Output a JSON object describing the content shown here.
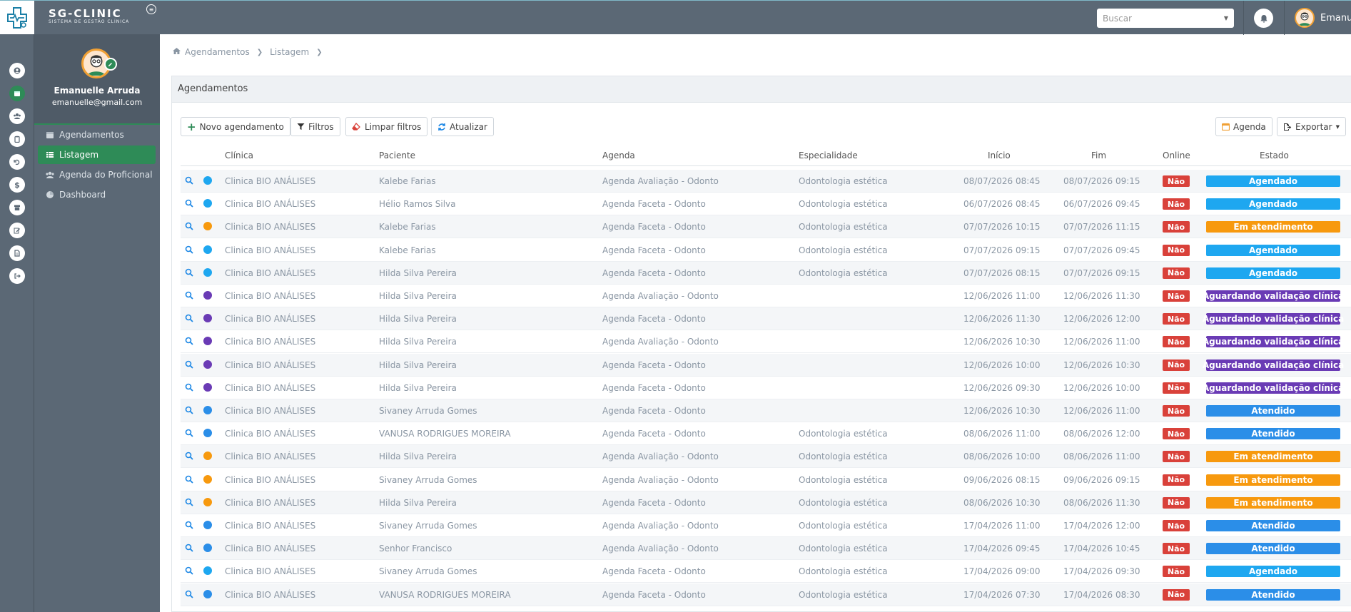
{
  "colors": {
    "topbar": "#5b6875",
    "accent": "#2e8b57",
    "danger": "#d9413a",
    "agendado": "#1ea7f0",
    "atendido": "#2b8ee8",
    "em_atendimento": "#f7990e",
    "aguardando": "#6a3bb5"
  },
  "brand": {
    "name": "SG-CLINIC",
    "tagline": "SISTEMA DE GESTÃO CLÍNICA"
  },
  "search": {
    "placeholder": "Buscar"
  },
  "topbar_user": {
    "name": "Emanue"
  },
  "rail_icons": [
    "user-circle-icon",
    "calendar-icon",
    "users-icon",
    "clipboard-icon",
    "refund-icon",
    "dollar-icon",
    "archive-icon",
    "edit-icon",
    "file-icon",
    "sign-out-icon"
  ],
  "profile": {
    "name": "Emanuelle Arruda",
    "email": "emanuelle@gmail.com"
  },
  "sidebar": {
    "items": [
      {
        "label": "Agendamentos",
        "icon": "calendar-icon"
      },
      {
        "label": "Listagem",
        "icon": "list-icon"
      },
      {
        "label": "Agenda do Proficional",
        "icon": "users-icon"
      },
      {
        "label": "Dashboard",
        "icon": "pie-chart-icon"
      }
    ]
  },
  "breadcrumb": {
    "home": "Agendamentos",
    "current": "Listagem"
  },
  "panel": {
    "title": "Agendamentos"
  },
  "toolbar": {
    "new": "Novo agendamento",
    "filters": "Filtros",
    "clear": "Limpar filtros",
    "refresh": "Atualizar",
    "agenda": "Agenda",
    "export": "Exportar"
  },
  "table": {
    "headers": {
      "clinica": "Clínica",
      "paciente": "Paciente",
      "agenda": "Agenda",
      "especialidade": "Especialidade",
      "inicio": "Início",
      "fim": "Fim",
      "online": "Online",
      "estado": "Estado"
    },
    "rows": [
      {
        "clinica": "Clinica BIO ANÁLISES",
        "paciente": "Kalebe Farias",
        "agenda": "Agenda Avaliação - Odonto",
        "especialidade": "Odontologia estética",
        "inicio": "08/07/2026 08:45",
        "fim": "08/07/2026 09:15",
        "online": "Não",
        "estado": "Agendado",
        "kind": "agendado"
      },
      {
        "clinica": "Clinica BIO ANÁLISES",
        "paciente": "Hélio Ramos Silva",
        "agenda": "Agenda Faceta - Odonto",
        "especialidade": "Odontologia estética",
        "inicio": "06/07/2026 08:45",
        "fim": "06/07/2026 09:45",
        "online": "Não",
        "estado": "Agendado",
        "kind": "agendado"
      },
      {
        "clinica": "Clinica BIO ANÁLISES",
        "paciente": "Kalebe Farias",
        "agenda": "Agenda Faceta - Odonto",
        "especialidade": "Odontologia estética",
        "inicio": "07/07/2026 10:15",
        "fim": "07/07/2026 11:15",
        "online": "Não",
        "estado": "Em atendimento",
        "kind": "em_atendimento"
      },
      {
        "clinica": "Clinica BIO ANÁLISES",
        "paciente": "Kalebe Farias",
        "agenda": "Agenda Faceta - Odonto",
        "especialidade": "Odontologia estética",
        "inicio": "07/07/2026 09:15",
        "fim": "07/07/2026 09:45",
        "online": "Não",
        "estado": "Agendado",
        "kind": "agendado"
      },
      {
        "clinica": "Clinica BIO ANÁLISES",
        "paciente": "Hilda Silva Pereira",
        "agenda": "Agenda Faceta - Odonto",
        "especialidade": "Odontologia estética",
        "inicio": "07/07/2026 08:15",
        "fim": "07/07/2026 09:15",
        "online": "Não",
        "estado": "Agendado",
        "kind": "agendado"
      },
      {
        "clinica": "Clinica BIO ANÁLISES",
        "paciente": "Hilda Silva Pereira",
        "agenda": "Agenda Avaliação - Odonto",
        "especialidade": "",
        "inicio": "12/06/2026 11:00",
        "fim": "12/06/2026 11:30",
        "online": "Não",
        "estado": "Aguardando validação clínica",
        "kind": "aguardando"
      },
      {
        "clinica": "Clinica BIO ANÁLISES",
        "paciente": "Hilda Silva Pereira",
        "agenda": "Agenda Faceta - Odonto",
        "especialidade": "",
        "inicio": "12/06/2026 11:30",
        "fim": "12/06/2026 12:00",
        "online": "Não",
        "estado": "Aguardando validação clínica",
        "kind": "aguardando"
      },
      {
        "clinica": "Clinica BIO ANÁLISES",
        "paciente": "Hilda Silva Pereira",
        "agenda": "Agenda Avaliação - Odonto",
        "especialidade": "",
        "inicio": "12/06/2026 10:30",
        "fim": "12/06/2026 11:00",
        "online": "Não",
        "estado": "Aguardando validação clínica",
        "kind": "aguardando"
      },
      {
        "clinica": "Clinica BIO ANÁLISES",
        "paciente": "Hilda Silva Pereira",
        "agenda": "Agenda Faceta - Odonto",
        "especialidade": "",
        "inicio": "12/06/2026 10:00",
        "fim": "12/06/2026 10:30",
        "online": "Não",
        "estado": "Aguardando validação clínica",
        "kind": "aguardando"
      },
      {
        "clinica": "Clinica BIO ANÁLISES",
        "paciente": "Hilda Silva Pereira",
        "agenda": "Agenda Faceta - Odonto",
        "especialidade": "",
        "inicio": "12/06/2026 09:30",
        "fim": "12/06/2026 10:00",
        "online": "Não",
        "estado": "Aguardando validação clínica",
        "kind": "aguardando"
      },
      {
        "clinica": "Clinica BIO ANÁLISES",
        "paciente": "Sivaney Arruda Gomes",
        "agenda": "Agenda Faceta - Odonto",
        "especialidade": "",
        "inicio": "12/06/2026 10:30",
        "fim": "12/06/2026 11:00",
        "online": "Não",
        "estado": "Atendido",
        "kind": "atendido"
      },
      {
        "clinica": "Clinica BIO ANÁLISES",
        "paciente": "VANUSA RODRIGUES MOREIRA",
        "agenda": "Agenda Faceta - Odonto",
        "especialidade": "Odontologia estética",
        "inicio": "08/06/2026 11:00",
        "fim": "08/06/2026 12:00",
        "online": "Não",
        "estado": "Atendido",
        "kind": "atendido"
      },
      {
        "clinica": "Clinica BIO ANÁLISES",
        "paciente": "Hilda Silva Pereira",
        "agenda": "Agenda Avaliação - Odonto",
        "especialidade": "Odontologia estética",
        "inicio": "08/06/2026 10:00",
        "fim": "08/06/2026 11:00",
        "online": "Não",
        "estado": "Em atendimento",
        "kind": "em_atendimento"
      },
      {
        "clinica": "Clinica BIO ANÁLISES",
        "paciente": "Sivaney Arruda Gomes",
        "agenda": "Agenda Avaliação - Odonto",
        "especialidade": "Odontologia estética",
        "inicio": "09/06/2026 08:15",
        "fim": "09/06/2026 09:15",
        "online": "Não",
        "estado": "Em atendimento",
        "kind": "em_atendimento"
      },
      {
        "clinica": "Clinica BIO ANÁLISES",
        "paciente": "Hilda Silva Pereira",
        "agenda": "Agenda Faceta - Odonto",
        "especialidade": "Odontologia estética",
        "inicio": "08/06/2026 10:30",
        "fim": "08/06/2026 11:30",
        "online": "Não",
        "estado": "Em atendimento",
        "kind": "em_atendimento"
      },
      {
        "clinica": "Clinica BIO ANÁLISES",
        "paciente": "Sivaney Arruda Gomes",
        "agenda": "Agenda Avaliação - Odonto",
        "especialidade": "Odontologia estética",
        "inicio": "17/04/2026 11:00",
        "fim": "17/04/2026 12:00",
        "online": "Não",
        "estado": "Atendido",
        "kind": "atendido"
      },
      {
        "clinica": "Clinica BIO ANÁLISES",
        "paciente": "Senhor Francisco",
        "agenda": "Agenda Avaliação - Odonto",
        "especialidade": "Odontologia estética",
        "inicio": "17/04/2026 09:45",
        "fim": "17/04/2026 10:45",
        "online": "Não",
        "estado": "Atendido",
        "kind": "atendido"
      },
      {
        "clinica": "Clinica BIO ANÁLISES",
        "paciente": "Sivaney Arruda Gomes",
        "agenda": "Agenda Faceta - Odonto",
        "especialidade": "Odontologia estética",
        "inicio": "17/04/2026 09:00",
        "fim": "17/04/2026 09:30",
        "online": "Não",
        "estado": "Agendado",
        "kind": "agendado"
      },
      {
        "clinica": "Clinica BIO ANÁLISES",
        "paciente": "VANUSA RODRIGUES MOREIRA",
        "agenda": "Agenda Faceta - Odonto",
        "especialidade": "Odontologia estética",
        "inicio": "17/04/2026 07:30",
        "fim": "17/04/2026 08:30",
        "online": "Não",
        "estado": "Atendido",
        "kind": "atendido"
      }
    ]
  }
}
